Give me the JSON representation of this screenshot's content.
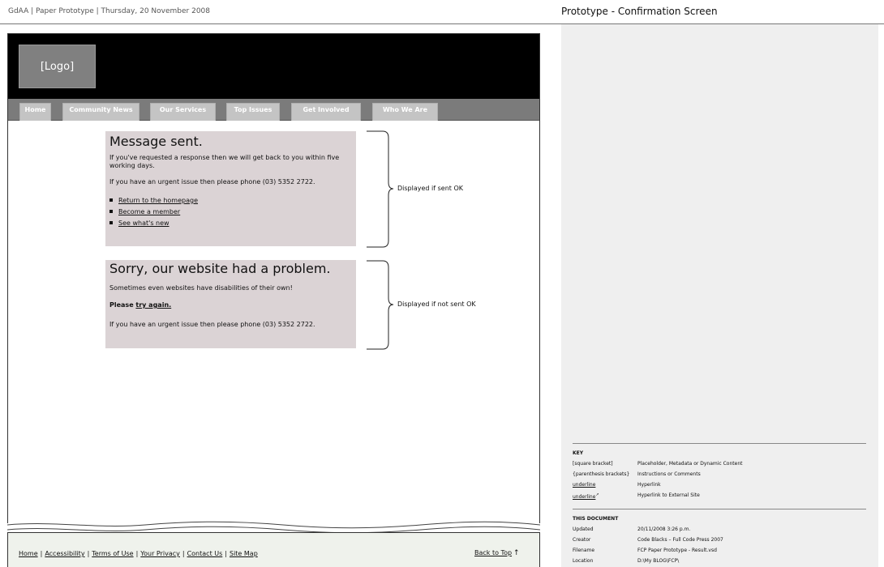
{
  "doc": {
    "meta": "GdAA | Paper Prototype | Thursday, 20 November 2008",
    "title": "Prototype - Confirmation Screen"
  },
  "site": {
    "logo": "[Logo]",
    "nav": [
      {
        "label": "Home"
      },
      {
        "label": "Community News"
      },
      {
        "label": "Our Services"
      },
      {
        "label": "Top Issues"
      },
      {
        "label": "Get Involved"
      },
      {
        "label": "Who We Are"
      }
    ]
  },
  "success": {
    "title": "Message sent.",
    "para1": "If you've requested a response then we will get back to you within five working days.",
    "para2": "If you have an urgent issue then please phone (03) 5352 2722.",
    "links": [
      {
        "label": "Return to the homepage"
      },
      {
        "label": "Become a member"
      },
      {
        "label": "See what's new"
      }
    ],
    "annotation": "Displayed if sent OK"
  },
  "error": {
    "title": "Sorry, our website had a problem.",
    "para1": "Sometimes even websites have disabilities of their own!",
    "retry_prefix": "Please ",
    "retry_link": "try again.",
    "para2": "If you have an urgent issue then please phone (03) 5352 2722.",
    "annotation": "Displayed if not sent OK"
  },
  "footer": {
    "links": [
      {
        "label": "Home"
      },
      {
        "label": "Accessibility"
      },
      {
        "label": "Terms of Use"
      },
      {
        "label": "Your Privacy"
      },
      {
        "label": "Contact Us"
      },
      {
        "label": "Site Map"
      }
    ],
    "separator": "|",
    "back_to_top": "Back to Top",
    "back_arrow": "↑"
  },
  "key": {
    "heading": "KEY",
    "rows": [
      {
        "k": "[square bracket]",
        "v": "Placeholder, Metadata or Dynamic Content"
      },
      {
        "k": "{parenthesis brackets}",
        "v": "Instructions or Comments"
      },
      {
        "k": "underline",
        "v": "Hyperlink"
      },
      {
        "k": "underline",
        "v": "Hyperlink to External Site"
      }
    ]
  },
  "this_document": {
    "heading": "THIS DOCUMENT",
    "rows": [
      {
        "k": "Updated",
        "v": "20/11/2008 3:26 p.m."
      },
      {
        "k": "Creator",
        "v": "Code Blacks – Full Code Press 2007"
      },
      {
        "k": "Filename",
        "v": "FCP Paper Prototype - Result.vsd"
      },
      {
        "k": "Location",
        "v": "D:\\My BLOG\\FCP\\"
      }
    ]
  }
}
